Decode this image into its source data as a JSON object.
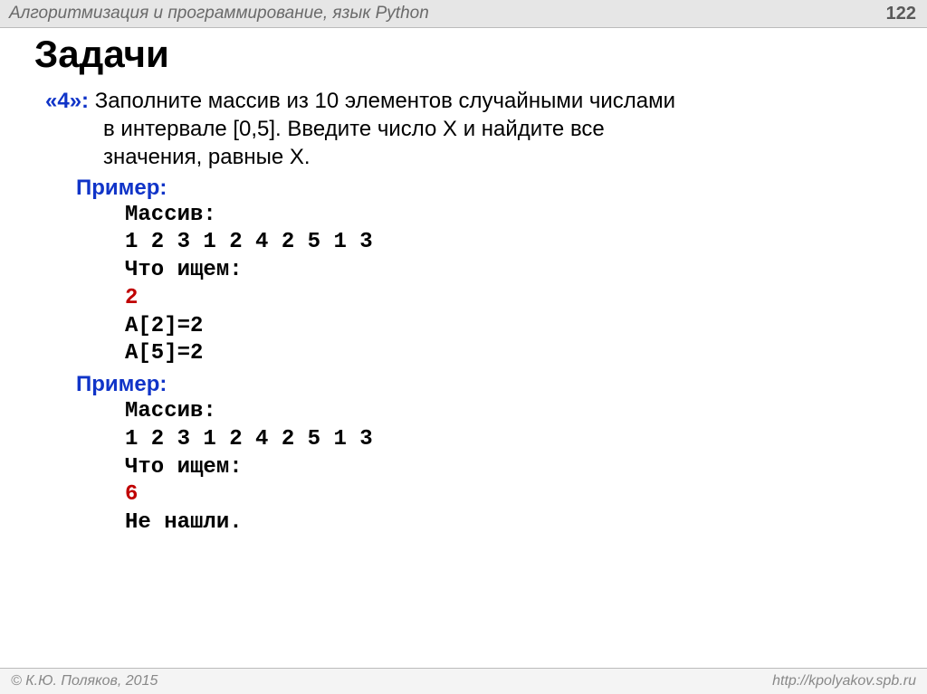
{
  "header": {
    "title": "Алгоритмизация и программирование, язык Python",
    "page": "122"
  },
  "title": "Задачи",
  "task": {
    "grade": "«4»:",
    "line1": " Заполните массив из 10 элементов случайными числами",
    "line2": "в интервале [0,5]. Введите число X и найдите все",
    "line3": "значения, равные X."
  },
  "example1": {
    "label": "Пример:",
    "arr_label": "Массив:",
    "arr": "1 2 3 1 2 4 2 5 1 3",
    "search_label": "Что ищем:",
    "search_val": "2",
    "res1": "A[2]=2",
    "res2": "A[5]=2"
  },
  "example2": {
    "label": "Пример:",
    "arr_label": "Массив:",
    "arr": "1 2 3 1 2 4 2 5 1 3",
    "search_label": "Что ищем:",
    "search_val": "6",
    "res": "Не нашли."
  },
  "footer": {
    "left": "© К.Ю. Поляков, 2015",
    "right": "http://kpolyakov.spb.ru"
  }
}
